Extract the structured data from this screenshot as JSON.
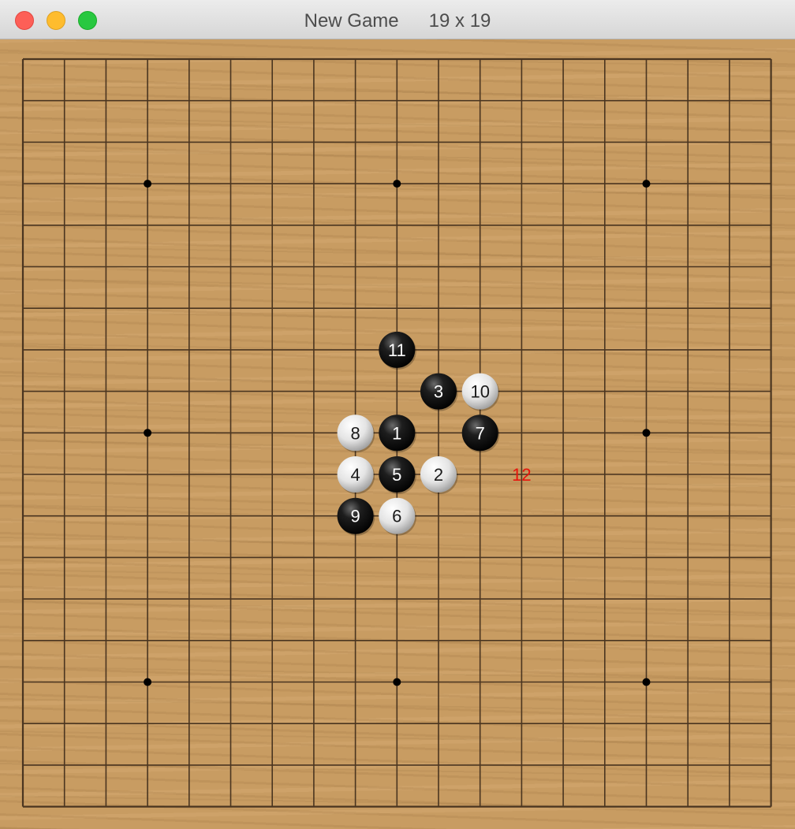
{
  "window": {
    "title": "New Game",
    "board_size_label": "19 x 19"
  },
  "board": {
    "size": 19,
    "star_points": [
      [
        3,
        3
      ],
      [
        3,
        9
      ],
      [
        3,
        15
      ],
      [
        9,
        3
      ],
      [
        9,
        15
      ],
      [
        15,
        3
      ],
      [
        15,
        9
      ],
      [
        15,
        15
      ]
    ],
    "colors": {
      "wood": "#c89c62",
      "line": "#4a3520",
      "next_move_label": "#e8140c"
    },
    "stones": [
      {
        "move": "1",
        "color": "black",
        "col": 9,
        "row": 9
      },
      {
        "move": "2",
        "color": "white",
        "col": 10,
        "row": 10
      },
      {
        "move": "3",
        "color": "black",
        "col": 10,
        "row": 8
      },
      {
        "move": "4",
        "color": "white",
        "col": 8,
        "row": 10
      },
      {
        "move": "5",
        "color": "black",
        "col": 9,
        "row": 10
      },
      {
        "move": "6",
        "color": "white",
        "col": 9,
        "row": 11
      },
      {
        "move": "7",
        "color": "black",
        "col": 11,
        "row": 9
      },
      {
        "move": "8",
        "color": "white",
        "col": 8,
        "row": 9
      },
      {
        "move": "9",
        "color": "black",
        "col": 8,
        "row": 11
      },
      {
        "move": "10",
        "color": "white",
        "col": 11,
        "row": 8
      },
      {
        "move": "11",
        "color": "black",
        "col": 9,
        "row": 7
      }
    ],
    "next_move": {
      "move": "12",
      "col": 12,
      "row": 10
    }
  }
}
